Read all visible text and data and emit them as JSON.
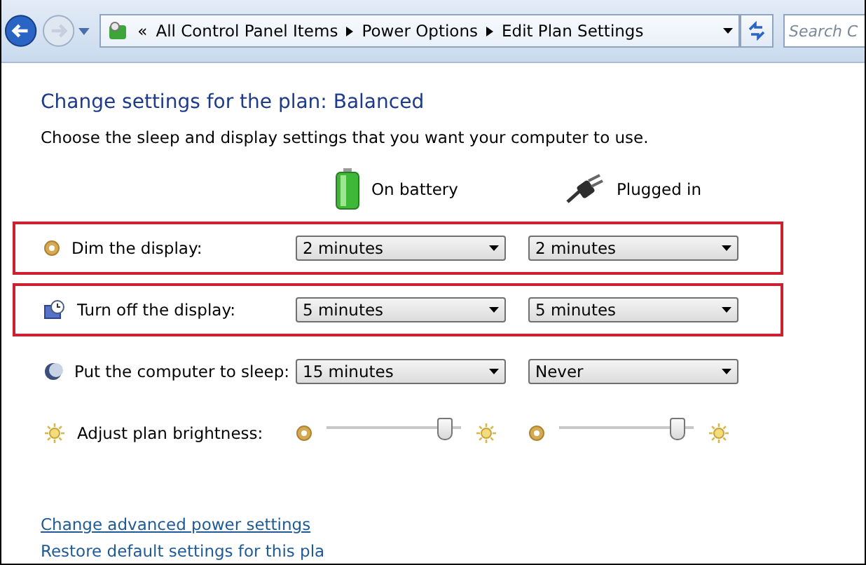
{
  "nav": {
    "chevron": "«",
    "breadcrumb": [
      "All Control Panel Items",
      "Power Options",
      "Edit Plan Settings"
    ],
    "search": {
      "placeholder": "Search C"
    }
  },
  "title": "Change settings for the plan: Balanced",
  "subtitle": "Choose the sleep and display settings that you want your computer to use.",
  "columns": [
    {
      "kind": "battery",
      "label": "On battery"
    },
    {
      "kind": "plug",
      "label": "Plugged in"
    }
  ],
  "settings": [
    {
      "kind": "dim",
      "label": "Dim the display:",
      "highlighted": true,
      "values": [
        "2 minutes",
        "2 minutes"
      ]
    },
    {
      "kind": "display-off",
      "label": "Turn off the display:",
      "highlighted": true,
      "values": [
        "5 minutes",
        "5 minutes"
      ]
    },
    {
      "kind": "sleep",
      "label": "Put the computer to sleep:",
      "highlighted": false,
      "values": [
        "15 minutes",
        "Never"
      ]
    },
    {
      "kind": "brightness",
      "label": "Adjust plan brightness:",
      "highlighted": false,
      "sliders": [
        {
          "level": 0.88
        },
        {
          "level": 0.88
        }
      ]
    }
  ],
  "links": [
    "Change advanced power settings",
    "Restore default settings for this pla"
  ]
}
